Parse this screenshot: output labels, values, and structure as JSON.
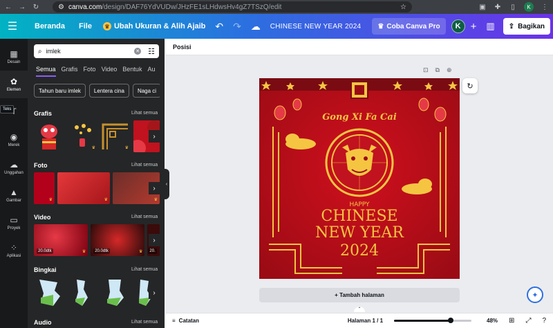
{
  "browser": {
    "url_host": "canva.com",
    "url_path": "/design/DAF76YdVUDw/JHzFE1sLHdwsHv4gZ7TSzQ/edit",
    "profile_initial": "K"
  },
  "header": {
    "home": "Beranda",
    "file": "File",
    "resize": "Ubah Ukuran & Alih Ajaib",
    "doc_title": "CHINESE NEW YEAR 2024",
    "pro": "Coba Canva Pro",
    "avatar": "K",
    "share": "Bagikan"
  },
  "rail": [
    {
      "label": "Desain",
      "icon": "layout-icon",
      "glyph": "▦"
    },
    {
      "label": "Elemen",
      "icon": "shapes-icon",
      "glyph": "✿"
    },
    {
      "label": "",
      "icon": "text-icon",
      "glyph": "T"
    },
    {
      "label": "Merek",
      "icon": "brand-icon",
      "glyph": "◉"
    },
    {
      "label": "Unggahan",
      "icon": "upload-icon",
      "glyph": "☁"
    },
    {
      "label": "Gambar",
      "icon": "image-icon",
      "glyph": "▲"
    },
    {
      "label": "Proyek",
      "icon": "folder-icon",
      "glyph": "▭"
    },
    {
      "label": "Aplikasi",
      "icon": "apps-icon",
      "glyph": "⁘"
    }
  ],
  "tooltip": "Teks",
  "search": {
    "value": "imlek"
  },
  "tabs": [
    "Semua",
    "Grafis",
    "Foto",
    "Video",
    "Bentuk",
    "Au"
  ],
  "chips": [
    "Tahun baru imlek",
    "Lentera cina",
    "Naga ci"
  ],
  "sections": {
    "graphics": "Grafis",
    "photos": "Foto",
    "videos": "Video",
    "frames": "Bingkai",
    "audio": "Audio",
    "see_all": "Lihat semua"
  },
  "video_durations": [
    "20.0dtk",
    "20.0dtk",
    "20."
  ],
  "canvas": {
    "position_label": "Posisi",
    "add_page": "+ Tambah halaman"
  },
  "poster": {
    "greeting": "Gong Xi Fa Cai",
    "happy": "HAPPY",
    "line1": "CHINESE",
    "line2": "NEW YEAR",
    "year": "2024",
    "primary_color": "#c1121f",
    "gold_color": "#f5c542"
  },
  "footer": {
    "notes": "Catatan",
    "pages": "Halaman 1 / 1",
    "zoom": "48%",
    "zoom_value": 48
  }
}
